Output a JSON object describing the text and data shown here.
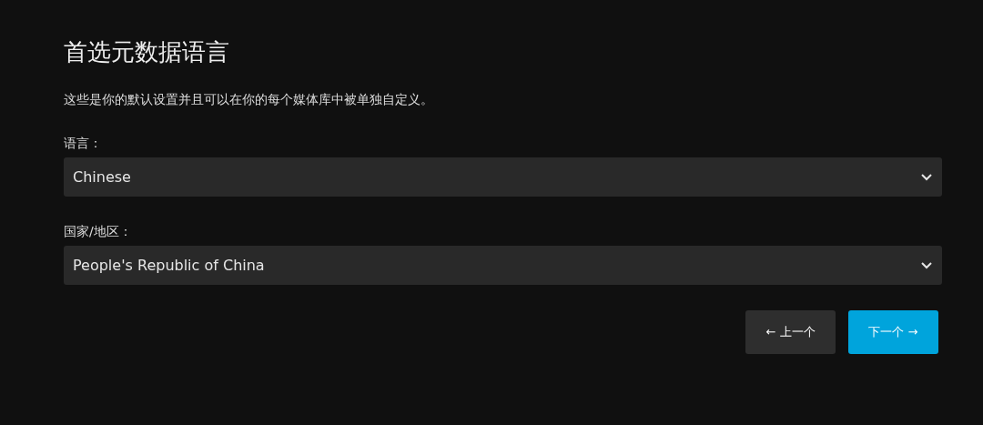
{
  "title": "首选元数据语言",
  "description": "这些是你的默认设置并且可以在你的每个媒体库中被单独自定义。",
  "fields": [
    {
      "label": "语言：",
      "value": "Chinese"
    },
    {
      "label": "国家/地区：",
      "value": "People's Republic of China"
    }
  ],
  "buttons": [
    {
      "label": "← 上一个",
      "kind": "secondary"
    },
    {
      "label": "下一个 →",
      "kind": "primary"
    }
  ]
}
